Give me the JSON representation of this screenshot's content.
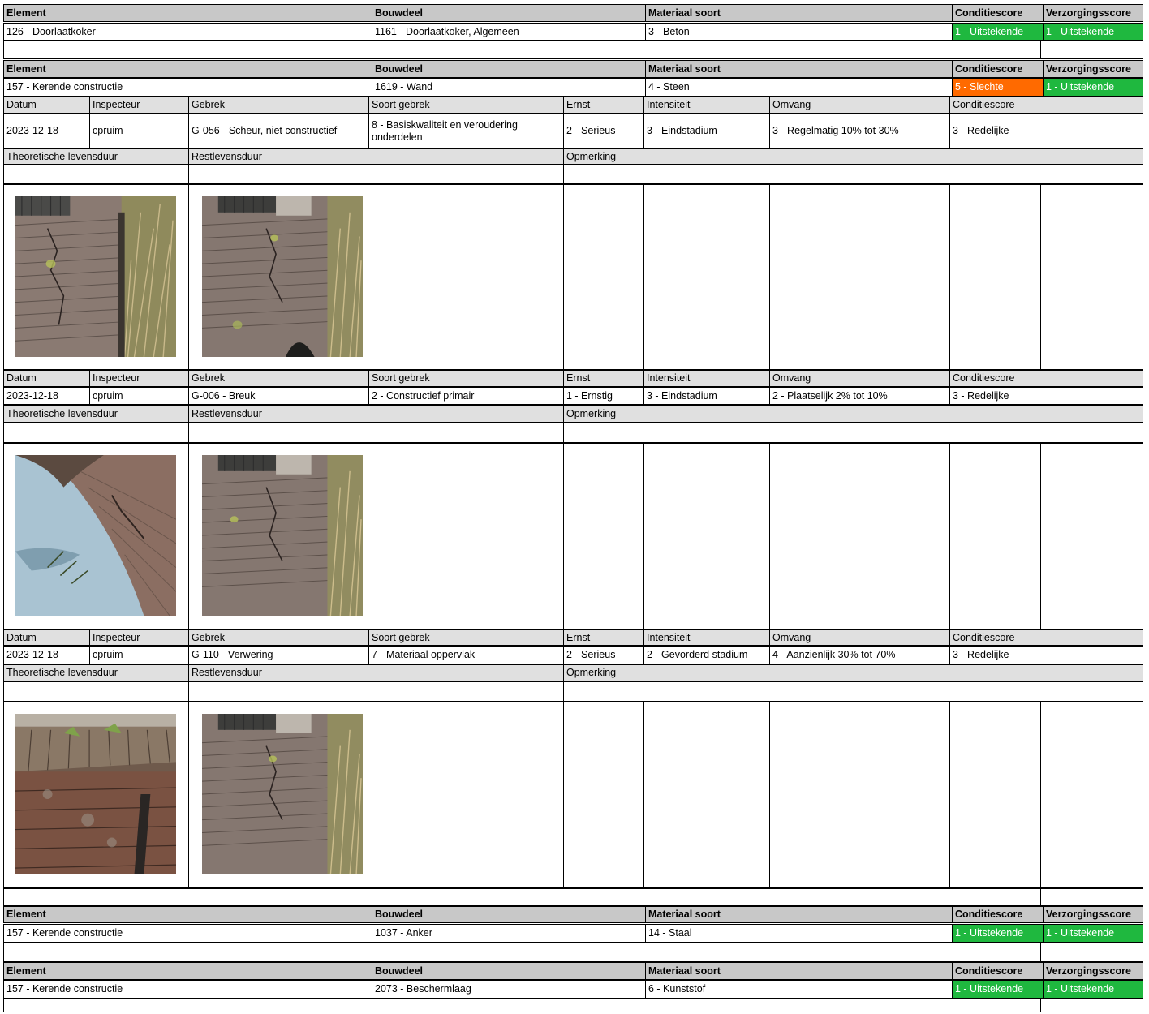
{
  "labels": {
    "element": "Element",
    "bouwdeel": "Bouwdeel",
    "materiaal": "Materiaal soort",
    "conditie": "Conditiescore",
    "verzorging": "Verzorgingsscore",
    "datum": "Datum",
    "inspecteur": "Inspecteur",
    "gebrek": "Gebrek",
    "soort_gebrek": "Soort gebrek",
    "ernst": "Ernst",
    "intensiteit": "Intensiteit",
    "omvang": "Omvang",
    "theoretische_levensduur": "Theoretische levensduur",
    "restlevensduur": "Restlevensduur",
    "opmerking": "Opmerking"
  },
  "elements": [
    {
      "element": "126 - Doorlaatkoker",
      "bouwdeel": "1161 - Doorlaatkoker, Algemeen",
      "materiaal": "3 - Beton",
      "conditie": "1 - Uitstekende",
      "verzorging": "1 - Uitstekende",
      "conditie_color": "#1fb83f",
      "verzorging_color": "#1fb83f"
    },
    {
      "element": "157 - Kerende constructie",
      "bouwdeel": "1619 - Wand",
      "materiaal": "4 - Steen",
      "conditie": "5 - Slechte",
      "verzorging": "1 - Uitstekende",
      "conditie_color": "#ff6a00",
      "verzorging_color": "#1fb83f"
    },
    {
      "element": "157 - Kerende constructie",
      "bouwdeel": "1037 - Anker",
      "materiaal": "14 - Staal",
      "conditie": "1 - Uitstekende",
      "verzorging": "1 - Uitstekende",
      "conditie_color": "#1fb83f",
      "verzorging_color": "#1fb83f"
    },
    {
      "element": "157 - Kerende constructie",
      "bouwdeel": "2073 - Beschermlaag",
      "materiaal": "6 - Kunststof",
      "conditie": "1 - Uitstekende",
      "verzorging": "1 - Uitstekende",
      "conditie_color": "#1fb83f",
      "verzorging_color": "#1fb83f"
    }
  ],
  "defects": [
    {
      "datum": "2023-12-18",
      "inspecteur": "cpruim",
      "gebrek": "G-056 - Scheur, niet constructief",
      "soort_gebrek": "8 - Basiskwaliteit en veroudering onderdelen",
      "ernst": "2 - Serieus",
      "intensiteit": "3 - Eindstadium",
      "omvang": "3 - Regelmatig 10% tot 30%",
      "conditie": "3 - Redelijke",
      "photos": [
        "brick-wall-photo-crack",
        "brick-wall-photo-overview"
      ]
    },
    {
      "datum": "2023-12-18",
      "inspecteur": "cpruim",
      "gebrek": "G-006 - Breuk",
      "soort_gebrek": "2 - Constructief primair",
      "ernst": "1 - Ernstig",
      "intensiteit": "3 - Eindstadium",
      "omvang": "2 - Plaatselijk 2% tot 10%",
      "conditie": "3 - Redelijke",
      "photos": [
        "culvert-arch-water-photo",
        "brick-wall-photo-overview"
      ]
    },
    {
      "datum": "2023-12-18",
      "inspecteur": "cpruim",
      "gebrek": "G-110 - Verwering",
      "soort_gebrek": "7 - Materiaal oppervlak",
      "ernst": "2 - Serieus",
      "intensiteit": "2 - Gevorderd stadium",
      "omvang": "4 - Aanzienlijk 30% tot 70%",
      "conditie": "3 - Redelijke",
      "photos": [
        "weathered-brick-coping-photo",
        "brick-wall-photo-overview"
      ]
    }
  ]
}
